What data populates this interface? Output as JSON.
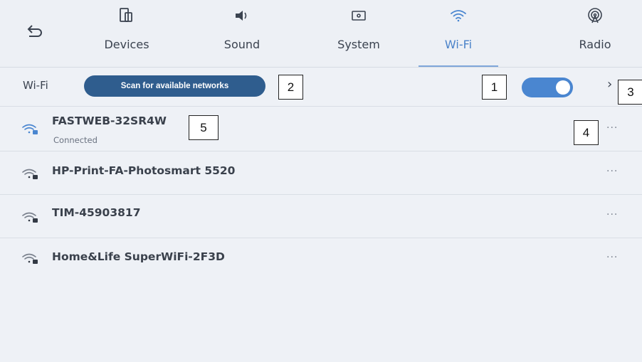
{
  "nav": {
    "tabs": [
      {
        "label": "Devices",
        "icon": "devices-icon"
      },
      {
        "label": "Sound",
        "icon": "speaker-icon"
      },
      {
        "label": "System",
        "icon": "system-icon"
      },
      {
        "label": "Wi-Fi",
        "icon": "wifi-icon",
        "active": true
      },
      {
        "label": "Radio",
        "icon": "radio-icon"
      }
    ],
    "back_icon": "back-arrow-icon"
  },
  "wifi_row": {
    "label": "Wi-Fi",
    "scan_button": "Scan for available networks",
    "toggle_on": true
  },
  "networks": [
    {
      "name": "FASTWEB-32SR4W",
      "status": "Connected",
      "connected": true
    },
    {
      "name": "HP-Print-FA-Photosmart 5520"
    },
    {
      "name": "TIM-45903817"
    },
    {
      "name": "Home&Life SuperWiFi-2F3D"
    }
  ],
  "annotations": [
    "1",
    "2",
    "3",
    "4",
    "5"
  ],
  "more_label": "···",
  "chevron_label": "›",
  "colors": {
    "accent": "#4a86d0",
    "scan_button": "#2f5d8e",
    "background": "#eef1f6"
  }
}
